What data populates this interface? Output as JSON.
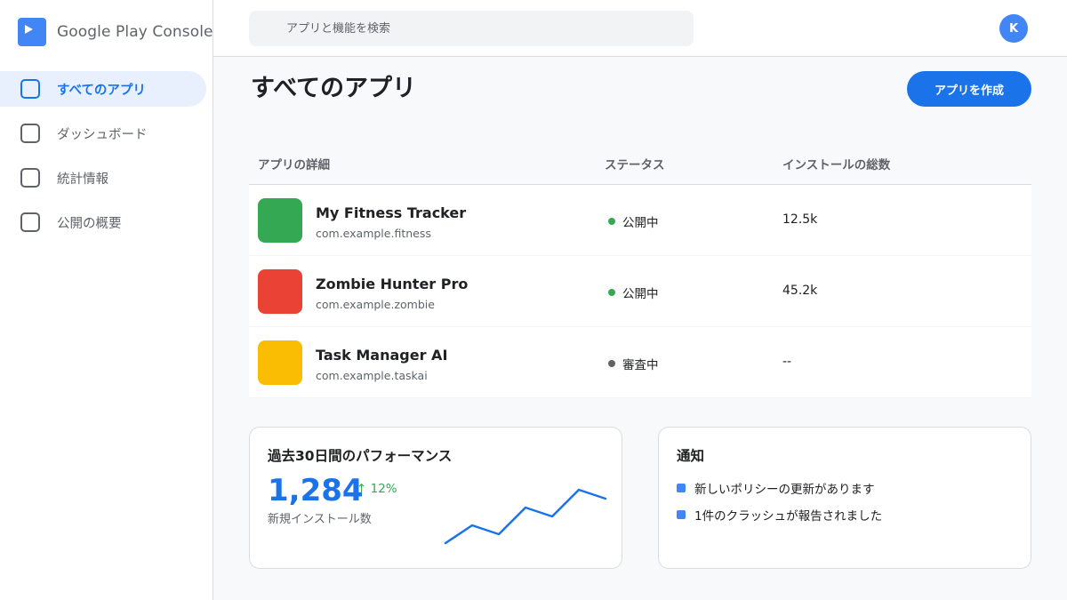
{
  "brand": {
    "name": "Google Play Console"
  },
  "sidebar": {
    "items": [
      {
        "label": "すべてのアプリ",
        "active": true
      },
      {
        "label": "ダッシュボード",
        "active": false
      },
      {
        "label": "統計情報",
        "active": false
      },
      {
        "label": "公開の概要",
        "active": false
      }
    ]
  },
  "header": {
    "search_placeholder": "アプリと機能を検索",
    "avatar_initial": "K"
  },
  "main": {
    "title": "すべてのアプリ",
    "create_button": "アプリを作成",
    "table": {
      "headers": [
        "アプリの詳細",
        "ステータス",
        "インストールの総数"
      ],
      "rows": [
        {
          "name": "My Fitness Tracker",
          "package": "com.example.fitness",
          "status": "公開中",
          "status_color": "#34a853",
          "installs": "12.5k",
          "icon_color": "#34a853"
        },
        {
          "name": "Zombie Hunter Pro",
          "package": "com.example.zombie",
          "status": "公開中",
          "status_color": "#34a853",
          "installs": "45.2k",
          "icon_color": "#ea4335"
        },
        {
          "name": "Task Manager AI",
          "package": "com.example.taskai",
          "status": "審査中",
          "status_color": "#5f6368",
          "installs": "--",
          "icon_color": "#fbbc04"
        }
      ]
    }
  },
  "performance": {
    "title": "過去30日間のパフォーマンス",
    "value": "1,284",
    "delta": "↑ 12%",
    "label": "新規インストール数",
    "sparkline": [
      2,
      4,
      3,
      6,
      5,
      8,
      7
    ]
  },
  "notifications": {
    "title": "通知",
    "items": [
      "新しいポリシーの更新があります",
      "1件のクラッシュが報告されました"
    ]
  },
  "colors": {
    "accent": "#1a73e8",
    "success": "#34a853"
  }
}
